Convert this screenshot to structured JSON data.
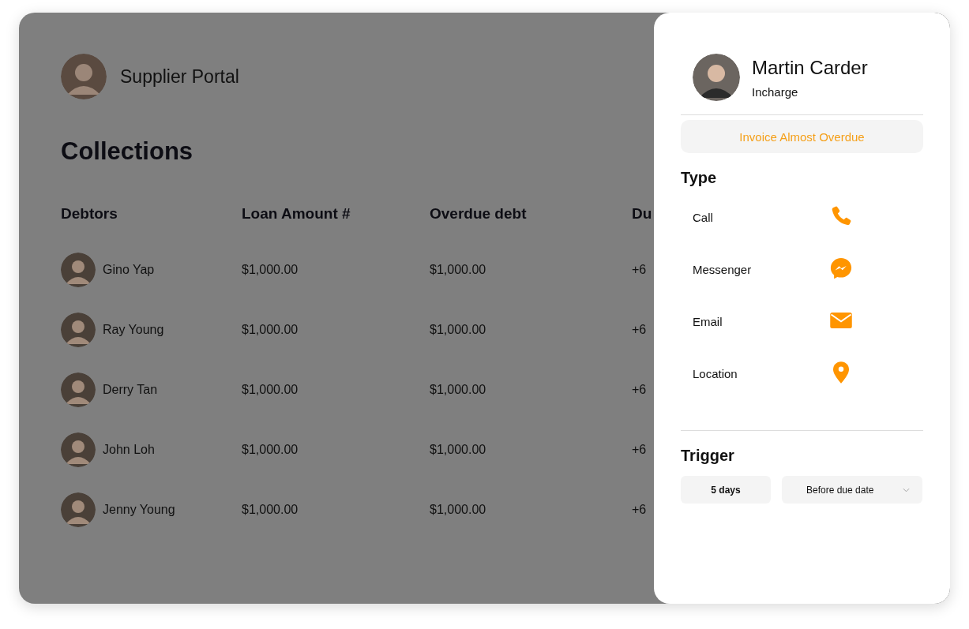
{
  "header": {
    "title": "Supplier Portal"
  },
  "page_title": "Collections",
  "table": {
    "columns": [
      "Debtors",
      "Loan Amount #",
      "Overdue debt",
      "Du"
    ],
    "rows": [
      {
        "name": "Gino Yap",
        "loan": "$1,000.00",
        "overdue": "$1,000.00",
        "column_4": "+6"
      },
      {
        "name": "Ray Young",
        "loan": "$1,000.00",
        "overdue": "$1,000.00",
        "column_4": "+6"
      },
      {
        "name": "Derry Tan",
        "loan": "$1,000.00",
        "overdue": "$1,000.00",
        "column_4": "+6"
      },
      {
        "name": "John Loh",
        "loan": "$1,000.00",
        "overdue": "$1,000.00",
        "column_4": "+6"
      },
      {
        "name": "Jenny Young",
        "loan": "$1,000.00",
        "overdue": "$1,000.00",
        "column_4": "+6"
      }
    ]
  },
  "panel": {
    "name": "Martin Carder",
    "role": "Incharge",
    "alert": "Invoice Almost Overdue",
    "type_heading": "Type",
    "types": [
      {
        "kind": "call",
        "label": "Call"
      },
      {
        "kind": "messenger",
        "label": "Messenger"
      },
      {
        "kind": "email",
        "label": "Email"
      },
      {
        "kind": "location",
        "label": "Location"
      }
    ],
    "trigger_heading": "Trigger",
    "days": "5 days",
    "timing": "Before due date"
  }
}
